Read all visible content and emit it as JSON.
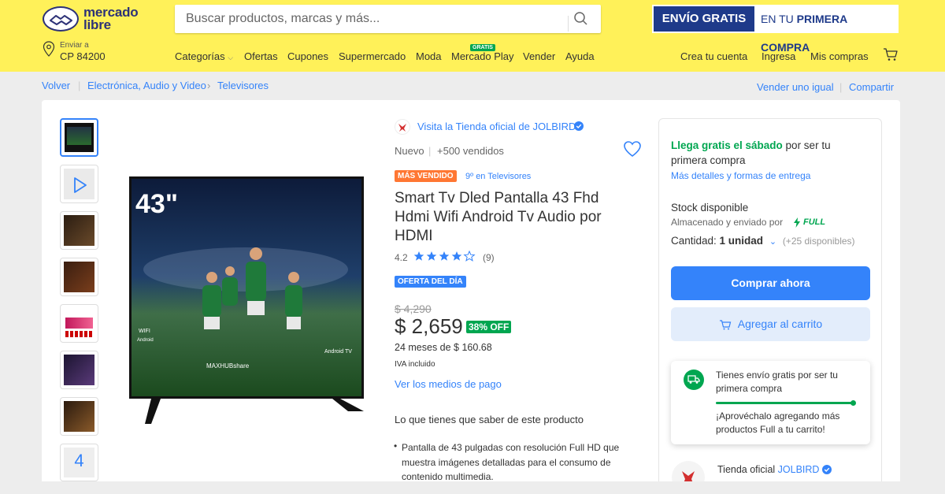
{
  "header": {
    "logo_line1": "mercado",
    "logo_line2": "libre",
    "search_placeholder": "Buscar productos, marcas y más...",
    "promo_left": "ENVÍO GRATIS",
    "promo_right_prefix": "EN TU ",
    "promo_right_bold": "PRIMERA COMPRA",
    "location_label": "Enviar a",
    "location_value": "CP 84200",
    "nav": [
      "Categorías",
      "Ofertas",
      "Cupones",
      "Supermercado",
      "Moda",
      "Mercado Play",
      "Vender",
      "Ayuda"
    ],
    "mercado_play_badge": "GRATIS",
    "user_nav": [
      "Crea tu cuenta",
      "Ingresa",
      "Mis compras"
    ]
  },
  "breadcrumb": {
    "back": "Volver",
    "items": [
      "Electrónica, Audio y Video",
      "Televisores"
    ],
    "right": [
      "Vender uno igual",
      "Compartir"
    ]
  },
  "thumbnails": {
    "last_thumb_label": "4"
  },
  "main_image": {
    "size_label": "43\"",
    "brand_label": "MAXHUBshare",
    "os_label": "Android TV",
    "wifi_label": "WIFI",
    "android_label": "Android"
  },
  "product": {
    "store_link": "Visita la Tienda oficial de JOLBIRD",
    "condition": "Nuevo",
    "sold": "+500 vendidos",
    "badge_best": "MÁS VENDIDO",
    "rank": "9º en Televisores",
    "title": "Smart Tv Dled Pantalla 43 Fhd Hdmi Wifi Android Tv Audio por HDMI",
    "rating": "4.2",
    "reviews": "(9)",
    "stars_filled": 4,
    "deal_badge": "OFERTA DEL DÍA",
    "old_price": "$ 4,290",
    "price": "$ 2,659",
    "discount": "38% OFF",
    "installments": "24 meses de $ 160.68",
    "tax": "IVA incluido",
    "payment_link": "Ver los medios de pago",
    "features_title": "Lo que tienes que saber de este producto",
    "feature_1": "Pantalla de 43 pulgadas con resolución Full HD que muestra imágenes detalladas para el consumo de contenido multimedia."
  },
  "buybox": {
    "shipping_green": "Llega gratis el sábado",
    "shipping_rest": " por ser tu primera compra",
    "shipping_link": "Más detalles y formas de entrega",
    "stock": "Stock disponible",
    "stored_by": "Almacenado y enviado por",
    "full": "FULL",
    "qty_label": "Cantidad: ",
    "qty_value": "1 unidad",
    "qty_available": "(+25 disponibles)",
    "buy_now": "Comprar ahora",
    "add_cart": "Agregar al carrito",
    "tooltip_title": "Tienes envío gratis por ser tu primera compra",
    "tooltip_body": "¡Aprovéchalo agregando más productos Full a tu carrito!",
    "seller_prefix": "Tienda oficial ",
    "seller_name": "JOLBIRD"
  },
  "colors": {
    "header_yellow": "#fff159",
    "accent_blue": "#3483fa",
    "green": "#00a650",
    "orange": "#ff7733"
  }
}
